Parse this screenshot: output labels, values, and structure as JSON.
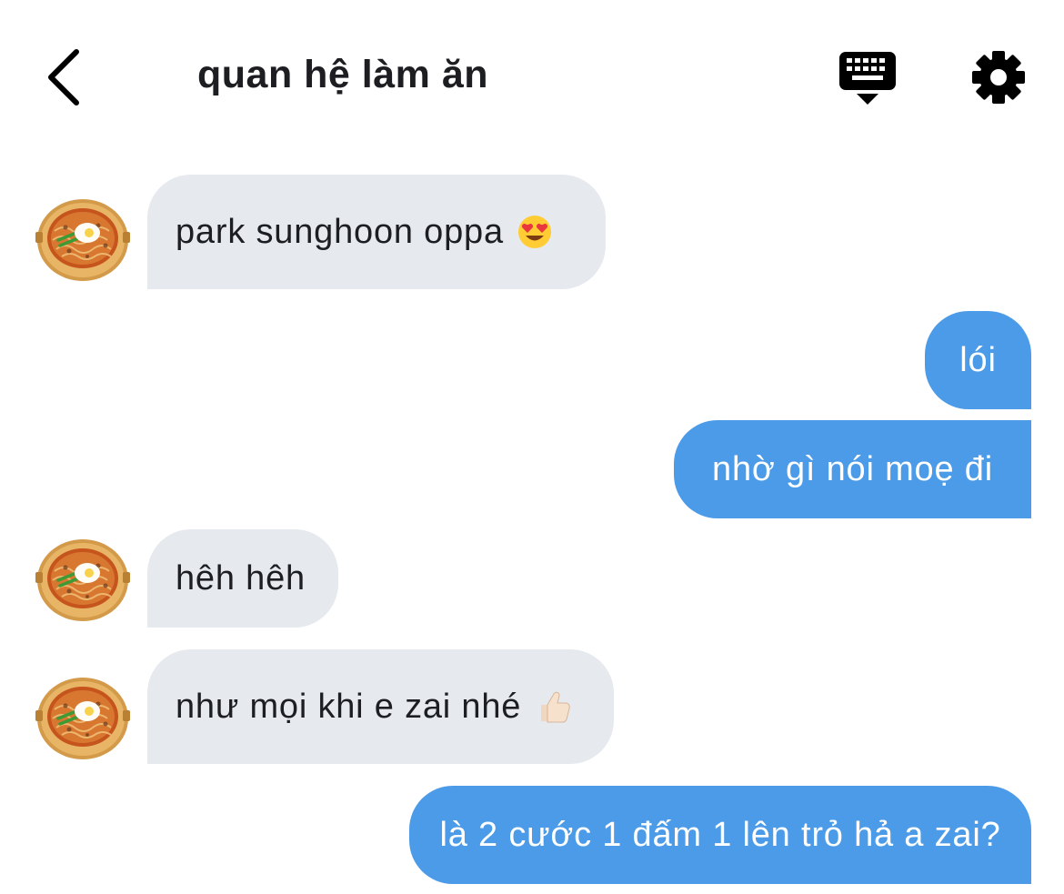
{
  "header": {
    "title": "quan hệ làm ăn",
    "icons": {
      "back": "chevron-left-icon",
      "keyboard": "keyboard-icon",
      "settings": "gear-icon"
    }
  },
  "messages": [
    {
      "side": "in",
      "text": "park sunghoon oppa",
      "emoji": "heart-eyes-emoji"
    },
    {
      "side": "out",
      "text": "lói"
    },
    {
      "side": "out",
      "text": "nhờ gì nói moẹ đi"
    },
    {
      "side": "in",
      "text": "hêh hêh"
    },
    {
      "side": "in",
      "text": "như mọi khi e zai nhé",
      "emoji": "thumbs-up-emoji"
    },
    {
      "side": "out",
      "text": "là 2 cước 1 đấm 1 lên trỏ hả a zai?"
    }
  ],
  "colors": {
    "incoming_bubble": "#e6e9ee",
    "outgoing_bubble": "#4c9be8",
    "text_dark": "#1c1e21",
    "text_light": "#ffffff"
  }
}
